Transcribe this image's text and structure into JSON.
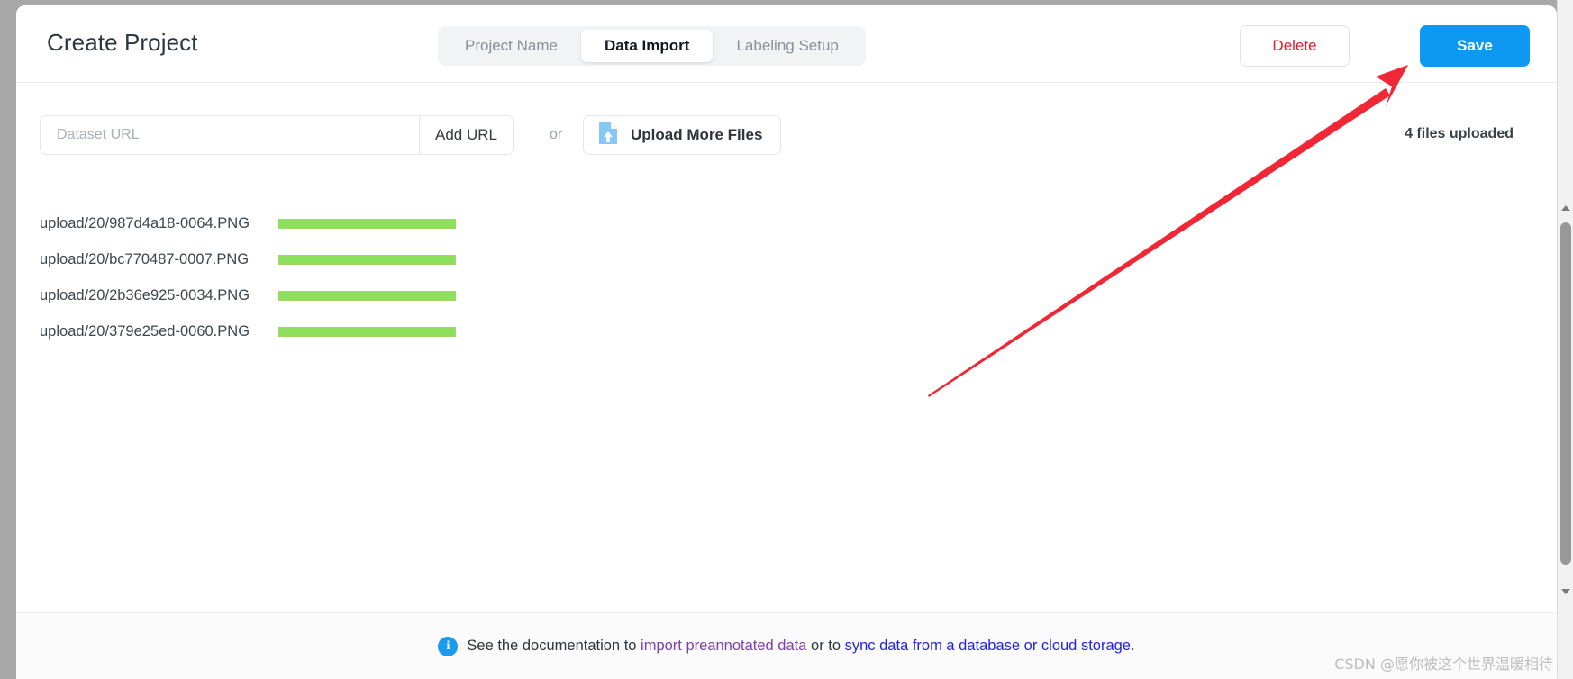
{
  "header": {
    "title": "Create Project",
    "tabs": [
      {
        "label": "Project Name",
        "active": false
      },
      {
        "label": "Data Import",
        "active": true
      },
      {
        "label": "Labeling Setup",
        "active": false
      }
    ],
    "delete_label": "Delete",
    "save_label": "Save",
    "delete_color": "#e8192c",
    "save_bg_color": "#0d99f2"
  },
  "import_bar": {
    "url_placeholder": "Dataset URL",
    "url_value": "",
    "add_url_label": "Add URL",
    "or_label": "or",
    "upload_more_files_label": "Upload More Files",
    "upload_icon": "file-upload-icon",
    "files_uploaded_label": "4 files uploaded"
  },
  "files": [
    {
      "name": "upload/20/987d4a18-0064.PNG",
      "progress": 100
    },
    {
      "name": "upload/20/bc770487-0007.PNG",
      "progress": 100
    },
    {
      "name": "upload/20/2b36e925-0034.PNG",
      "progress": 100
    },
    {
      "name": "upload/20/379e25ed-0060.PNG",
      "progress": 100
    }
  ],
  "progress_colors": {
    "fill": "#8ce05b",
    "border": "#9fd66d"
  },
  "footer": {
    "info_icon": "info-icon",
    "info_glyph": "i",
    "text_before": "See the documentation to ",
    "link_preannotated": "import preannotated data",
    "text_middle": " or to ",
    "link_sync": "sync data from a database or cloud storage",
    "text_after": ".",
    "link_visited_color": "#7d3fa8",
    "link_color": "#2323dd"
  },
  "annotation": {
    "arrow_color": "#f02735",
    "points": "tail(1031,440) head(1562,73)"
  },
  "watermark": {
    "text": "CSDN @愿你被这个世界温暖相待"
  },
  "scrollbar": {
    "up_arrow": "chevron-up-icon",
    "down_arrow": "chevron-down-icon"
  }
}
